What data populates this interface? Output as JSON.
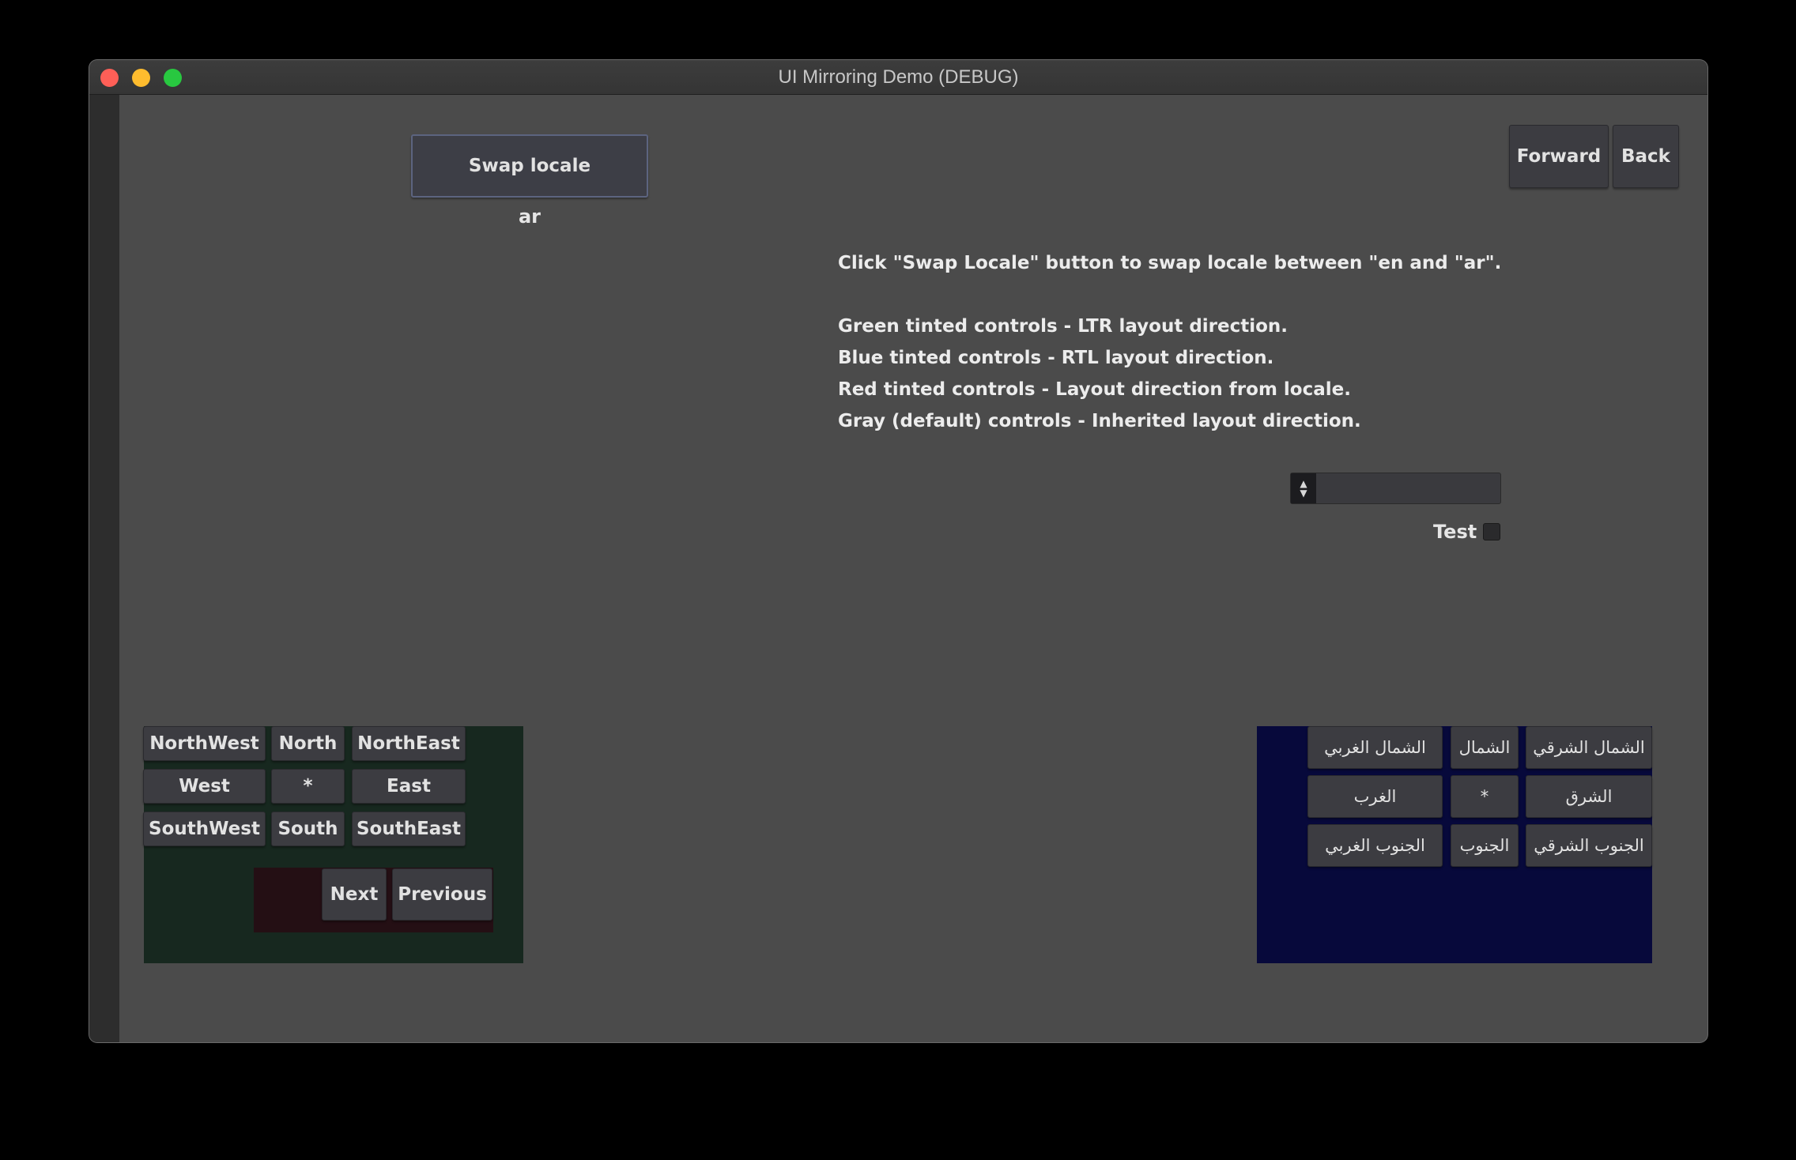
{
  "window": {
    "title": "UI Mirroring Demo (DEBUG)"
  },
  "toolbar": {
    "swap_label": "Swap locale",
    "locale_value": "ar",
    "forward_label": "Forward",
    "back_label": "Back"
  },
  "info": {
    "line1": "Click \"Swap Locale\" button to swap locale between \"en  and \"ar\".",
    "line2": "Green tinted controls - LTR layout direction.",
    "line3": "Blue tinted controls - RTL layout direction.",
    "line4": "Red tinted controls - Layout direction from locale.",
    "line5": "Gray (default) controls - Inherited layout direction."
  },
  "controls": {
    "spinner_value": "",
    "checkbox_label": "Test",
    "checkbox_checked": false
  },
  "ltr_grid": {
    "northwest": "NorthWest",
    "north": "North",
    "northeast": "NorthEast",
    "west": "West",
    "center": "*",
    "east": "East",
    "southwest": "SouthWest",
    "south": "South",
    "southeast": "SouthEast"
  },
  "locale_nav": {
    "next": "Next",
    "previous": "Previous"
  },
  "rtl_grid": {
    "northwest": "الشمال الغربي",
    "north": "الشمال",
    "northeast": "الشمال الشرقي",
    "west": "الغرب",
    "center": "*",
    "east": "الشرق",
    "southwest": "الجنوب الغربي",
    "south": "الجنوب",
    "southeast": "الجنوب الشرقي"
  },
  "colors": {
    "ltr_tint": "#17281f",
    "rtl_tint": "#07093b",
    "locale_tint": "#240f14",
    "window_bg": "#4b4b4b"
  }
}
